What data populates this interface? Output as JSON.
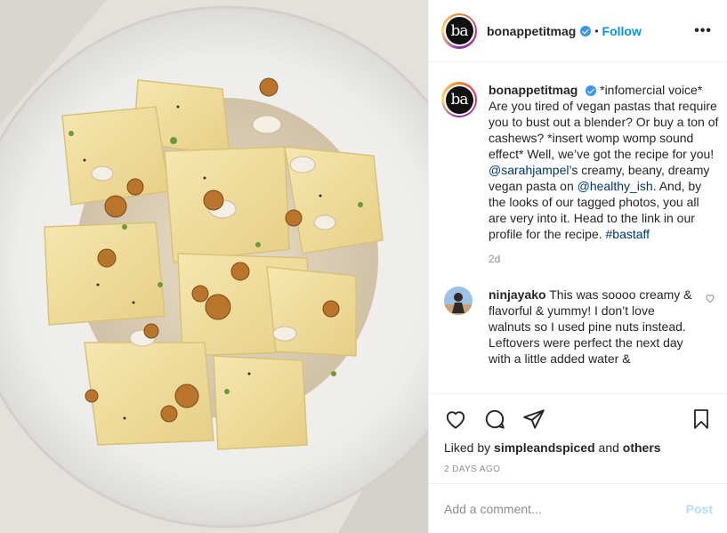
{
  "post": {
    "image_alt": "paccheri pasta with white beans and toasted walnuts in a white bowl"
  },
  "header": {
    "avatar_text": "ba",
    "username": "bonappetitmag",
    "verified_icon": "verified-badge-icon",
    "separator": "•",
    "follow_label": "Follow",
    "more_label": "•••"
  },
  "caption": {
    "avatar_text": "ba",
    "username": "bonappetitmag",
    "text_1": "*infomercial voice* Are you tired of vegan pastas that require you to bust out a blender? Or buy a ton of cashews? *insert womp womp sound effect* Well, we’ve got the recipe for you! ",
    "mention_1": "@sarahjampel",
    "text_2": "’s creamy, beany, dreamy vegan pasta on ",
    "mention_2": "@healthy_ish",
    "text_3": ". And, by the looks of our tagged photos, you all are very into it. Head to the link in our profile for the recipe. ",
    "hashtag": "#bastaff",
    "time": "2d"
  },
  "comments": [
    {
      "username": "ninjayako",
      "text": "This was soooo creamy & flavorful & yummy! I don’t love walnuts so I used pine nuts instead. Leftovers were perfect the next day with a little added water &"
    }
  ],
  "actions": {
    "like_icon": "heart-icon",
    "comment_icon": "comment-icon",
    "share_icon": "share-icon",
    "save_icon": "bookmark-icon"
  },
  "likes": {
    "prefix": "Liked by ",
    "user": "simpleandspiced",
    "joiner": " and ",
    "others": "others"
  },
  "date": "2 DAYS AGO",
  "add_comment": {
    "placeholder": "Add a comment...",
    "post_label": "Post"
  },
  "colors": {
    "link": "#00376b",
    "follow": "#0095f6",
    "post_disabled": "#b2dffc",
    "muted": "#8e8e8e"
  }
}
